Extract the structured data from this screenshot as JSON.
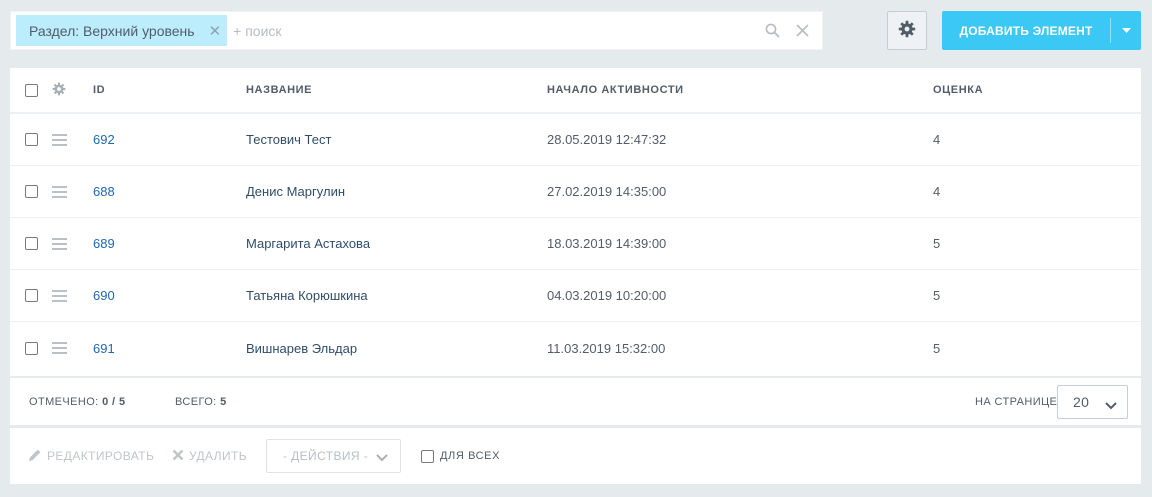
{
  "filter": {
    "tag_label": "Раздел: Верхний уровень",
    "search_placeholder": "+ поиск",
    "search_value": ""
  },
  "toolbar": {
    "add_label": "ДОБАВИТЬ ЭЛЕМЕНТ"
  },
  "table": {
    "columns": {
      "id": "ID",
      "name": "НАЗВАНИЕ",
      "active_from": "НАЧАЛО АКТИВНОСТИ",
      "rating": "ОЦЕНКА"
    },
    "rows": [
      {
        "id": "692",
        "name": "Тестович Тест",
        "active_from": "28.05.2019 12:47:32",
        "rating": "4"
      },
      {
        "id": "688",
        "name": "Денис Маргулин",
        "active_from": "27.02.2019 14:35:00",
        "rating": "4"
      },
      {
        "id": "689",
        "name": "Маргарита Астахова",
        "active_from": "18.03.2019 14:39:00",
        "rating": "5"
      },
      {
        "id": "690",
        "name": "Татьяна Корюшкина",
        "active_from": "04.03.2019 10:20:00",
        "rating": "5"
      },
      {
        "id": "691",
        "name": "Вишнарев Эльдар",
        "active_from": "11.03.2019 15:32:00",
        "rating": "5"
      }
    ]
  },
  "footer": {
    "selected_label": "ОТМЕЧЕНО:",
    "selected_value": "0 / 5",
    "total_label": "ВСЕГО:",
    "total_value": "5",
    "per_page_label": "НА СТРАНИЦЕ:",
    "per_page_value": "20"
  },
  "actions": {
    "edit_label": "РЕДАКТИРОВАТЬ",
    "delete_label": "УДАЛИТЬ",
    "actions_select": "- ДЕЙСТВИЯ -",
    "for_all_label": "ДЛЯ ВСЕХ"
  },
  "colors": {
    "accent": "#3bc8f5",
    "tag_bg": "#bcedfc",
    "link": "#2067b0",
    "page_bg": "#e5ebed"
  },
  "icons": {
    "search": "search-icon",
    "clear": "close-icon",
    "settings": "gear-icon",
    "drag": "drag-handle-icon",
    "edit": "pencil-icon",
    "delete": "cross-icon",
    "chevron": "chevron-down-icon"
  }
}
